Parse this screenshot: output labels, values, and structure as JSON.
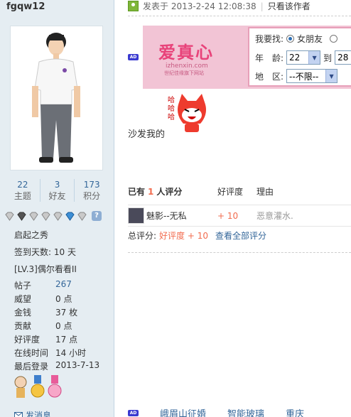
{
  "user": {
    "name": "fgqw12",
    "stats": [
      {
        "value": "22",
        "label": "主题"
      },
      {
        "value": "3",
        "label": "好友"
      },
      {
        "value": "173",
        "label": "积分"
      }
    ],
    "rank": "启起之秀",
    "checkin": "签到天数: 10 天",
    "level": "[LV.3]偶尔看看II",
    "info": [
      {
        "k": "帖子",
        "v": "267"
      },
      {
        "k": "威望",
        "v": "0 点"
      },
      {
        "k": "金钱",
        "v": "37 枚"
      },
      {
        "k": "贡献",
        "v": "0 点"
      },
      {
        "k": "好评度",
        "v": "17 点"
      },
      {
        "k": "在线时间",
        "v": "14 小时"
      },
      {
        "k": "最后登录",
        "v": "2013-7-13"
      }
    ],
    "send_message": "发消息"
  },
  "post": {
    "posted_at": "发表于  2013-2-24 12:08:38",
    "only_author": "只看该作者",
    "content": "沙发我的",
    "laugh_text": "哈哈哈"
  },
  "ad": {
    "badge": "AD",
    "logo": "爱真心",
    "url": "izhenxin.com",
    "tagline": "世纪佳缘旗下网站",
    "looking_label": "我要找:",
    "option_girlfriend": "女朋友",
    "age_label": "年　龄:",
    "age_from": "22",
    "age_to_label": "到",
    "age_to": "28",
    "region_label": "地　区:",
    "region_value": "--不限--"
  },
  "rating": {
    "header_prefix": "已有",
    "header_count": "1",
    "header_suffix": "人评分",
    "col_score": "好评度",
    "col_reason": "理由",
    "rows": [
      {
        "user": "魅影--无私",
        "score": "+ 10",
        "reason": "恶意灌水."
      }
    ],
    "total_label": "总评分:",
    "total_value": "好评度  + 10",
    "view_all": "查看全部评分"
  },
  "bottom_ads": {
    "badge": "AD",
    "links": [
      "峨眉山征婚",
      "智能玻璃",
      "重庆"
    ]
  },
  "colors": {
    "accent": "#336699",
    "score": "#f26c4f",
    "side_bg": "#e5edf2"
  }
}
